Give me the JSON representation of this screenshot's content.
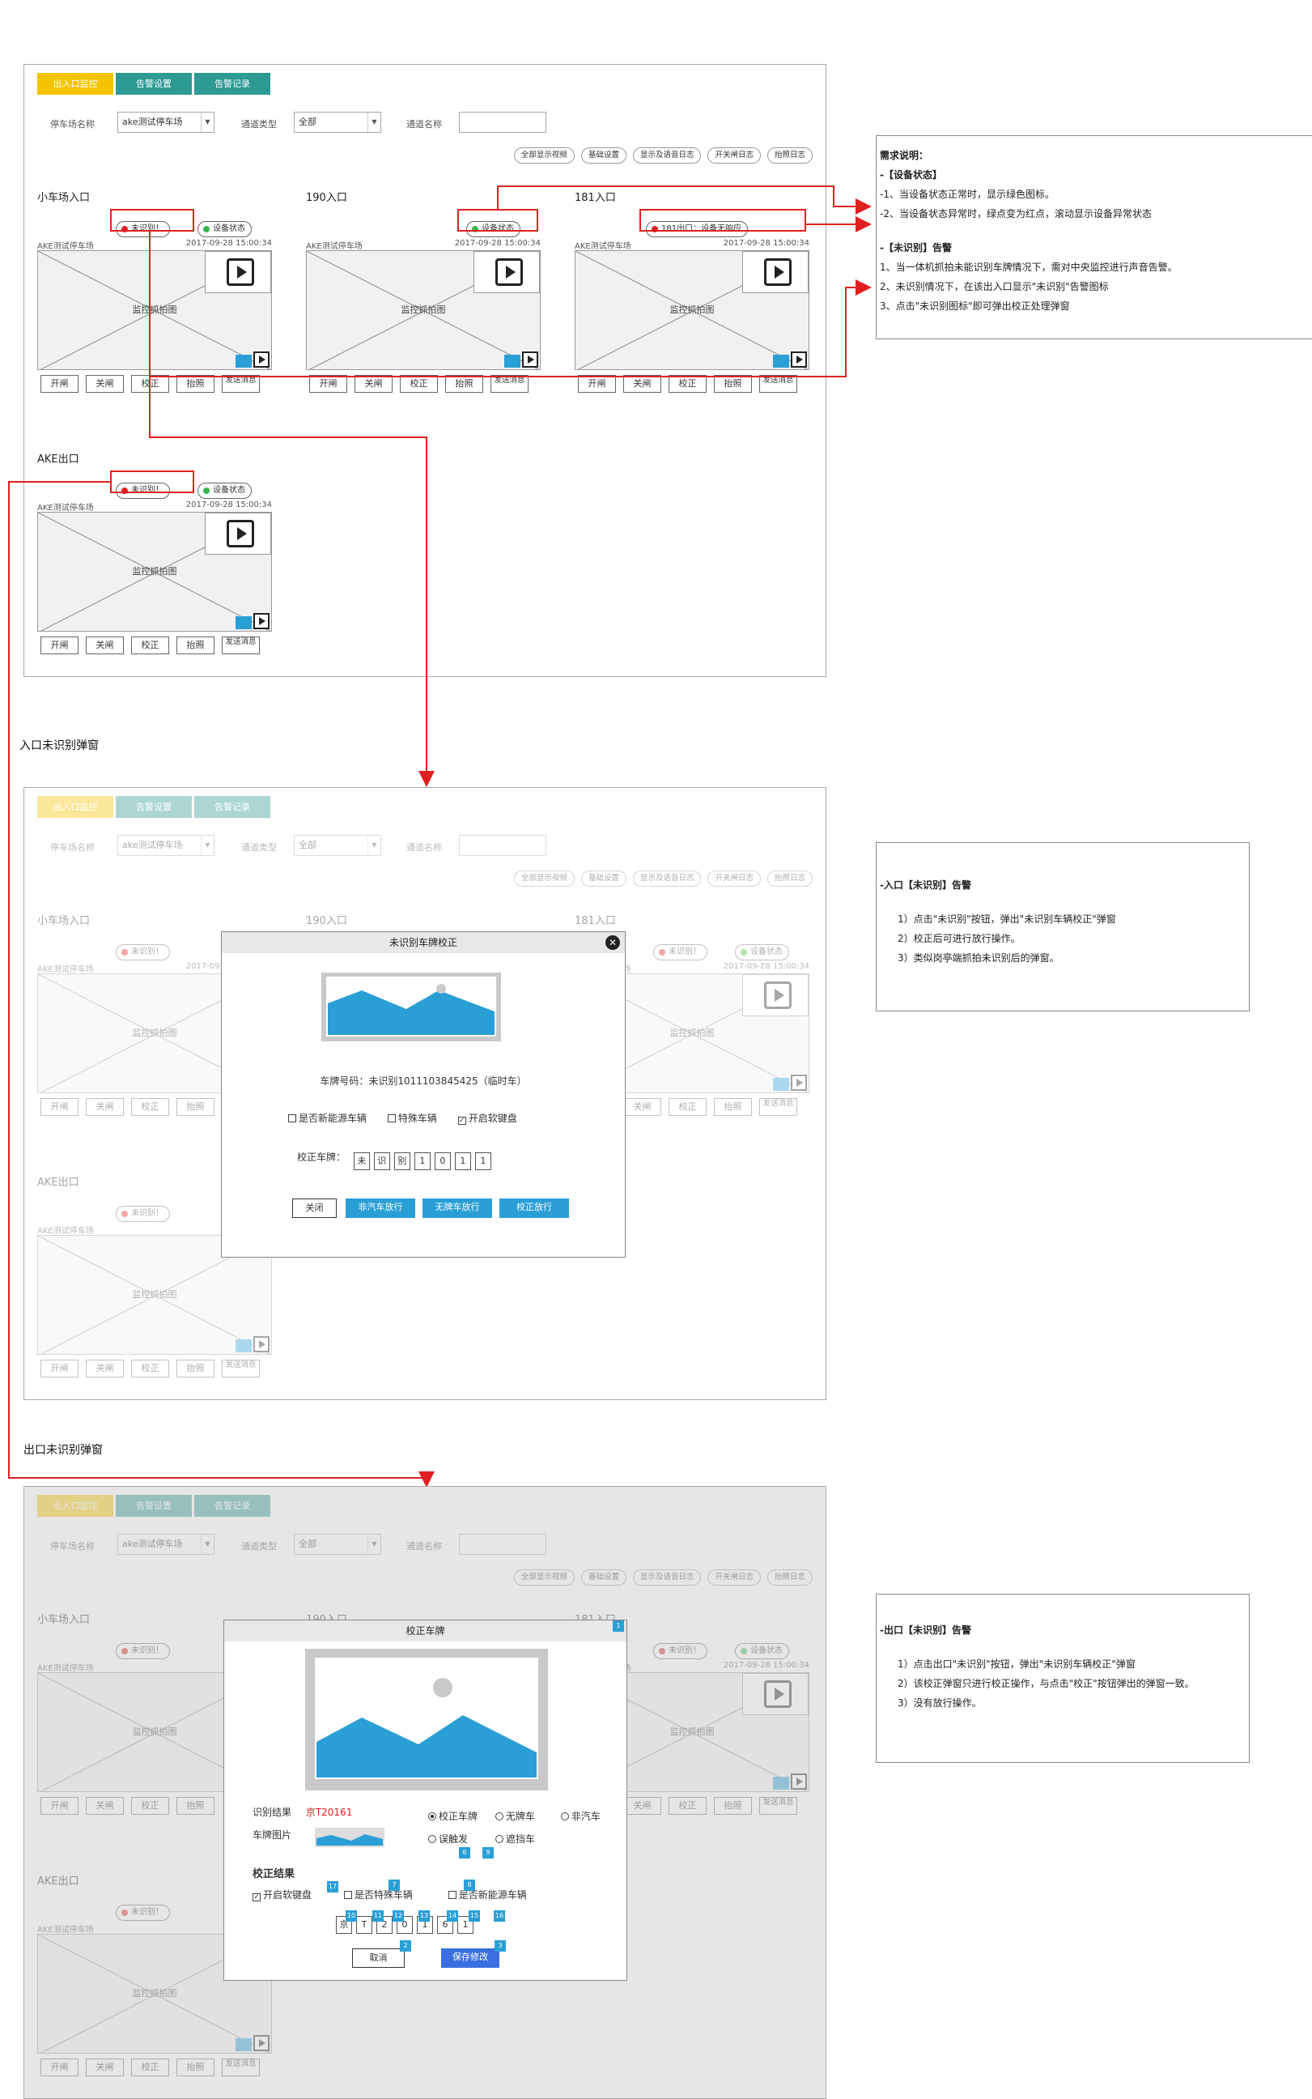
{
  "tabs": [
    "出入口监控",
    "告警设置",
    "告警记录"
  ],
  "filters": {
    "lot_label": "停车场名称",
    "lot_value": "ake测试停车场",
    "type_label": "通道类型",
    "type_value": "全部",
    "channel_label": "通道名称"
  },
  "actions": [
    "全部显示视频",
    "基础设置",
    "显示及语音日志",
    "开关闸日志",
    "抬照日志"
  ],
  "lanes": [
    {
      "title": "小车场入口",
      "lot": "AKE测试停车场",
      "time": "2017-09-28 15:00:34"
    },
    {
      "title": "190入口",
      "lot": "AKE测试停车场",
      "time": "2017-09-28 15:00:34"
    },
    {
      "title": "181入口",
      "lot": "AKE测试停车场",
      "time": "2017-09-28 15:00:34"
    },
    {
      "title": "AKE出口",
      "lot": "AKE测试停车场",
      "time": "2017-09-28 15:00:34"
    }
  ],
  "badges": {
    "unrec": "未识别！",
    "status": "设备状态",
    "offline": "181出口：设备无响应"
  },
  "video_caption": "监控抓拍图",
  "lane_ops": [
    "开闸",
    "关闸",
    "校正",
    "抬照",
    "发送消息"
  ],
  "section_titles": {
    "entry": "入口未识别弹窗",
    "exit": "出口未识别弹窗"
  },
  "note1": {
    "title": "需求说明：",
    "h1": "-【设备状态】",
    "l1": "-1、当设备状态正常时，显示绿色图标。",
    "l2": "-2、当设备状态异常时，绿点变为红点，滚动显示设备异常状态",
    "h2": "-【未识别】告警",
    "l3": "1、当一体机抓拍未能识别车牌情况下，需对中央监控进行声音告警。",
    "l4": "2、未识别情况下，在该出入口显示\"未识别\"告警图标",
    "l5": "3、点击\"未识别图标\"即可弹出校正处理弹窗"
  },
  "note2": {
    "title": "-入口【未识别】告警",
    "l1": "1）点击\"未识别\"按钮，弹出\"未识别车辆校正\"弹窗",
    "l2": "2）校正后可进行放行操作。",
    "l3": "3）类似岗亭端抓拍未识别后的弹窗。"
  },
  "note3": {
    "title": "-出口【未识别】告警",
    "l1": "1）点击出口\"未识别\"按钮，弹出\"未识别车辆校正\"弹窗",
    "l2": "2）该校正弹窗只进行校正操作，与点击\"校正\"按钮弹出的弹窗一致。",
    "l3": "3）没有放行操作。"
  },
  "modal1": {
    "title": "未识别车牌校正",
    "plate_info": "车牌号码：未识别1011103845425（临时车）",
    "opt1": "是否新能源车辆",
    "opt2": "特殊车辆",
    "opt3": "开启软键盘",
    "correct_label": "校正车牌：",
    "chars": [
      "未",
      "识",
      "别",
      "1",
      "0",
      "1",
      "1"
    ],
    "btn_close": "关闭",
    "btn_nonauto": "非汽车放行",
    "btn_noplate": "无牌车放行",
    "btn_fix": "校正放行"
  },
  "modal2": {
    "title": "校正车牌",
    "result_label": "识别结果",
    "result_value": "京T20161",
    "img_label": "车牌图片",
    "r1": "校正车牌",
    "r2": "无牌车",
    "r3": "非汽车",
    "r4": "误触发",
    "r5": "遮挡车",
    "fix_title": "校正结果",
    "c1": "开启软键盘",
    "c2": "是否特殊车辆",
    "c3": "是否新能源车辆",
    "chars": [
      "京",
      "T",
      "2",
      "0",
      "1",
      "6",
      "1"
    ],
    "cancel": "取消",
    "save": "保存修改",
    "nums": [
      "1",
      "2",
      "3",
      "6",
      "7",
      "8",
      "9",
      "10",
      "11",
      "12",
      "13",
      "14",
      "15",
      "16",
      "17"
    ]
  },
  "colors": {
    "tab_active": "#f5c400",
    "tab": "#2e9a94",
    "accent": "#2a9fd6",
    "red": "#e02020",
    "green": "#3bb54a"
  }
}
